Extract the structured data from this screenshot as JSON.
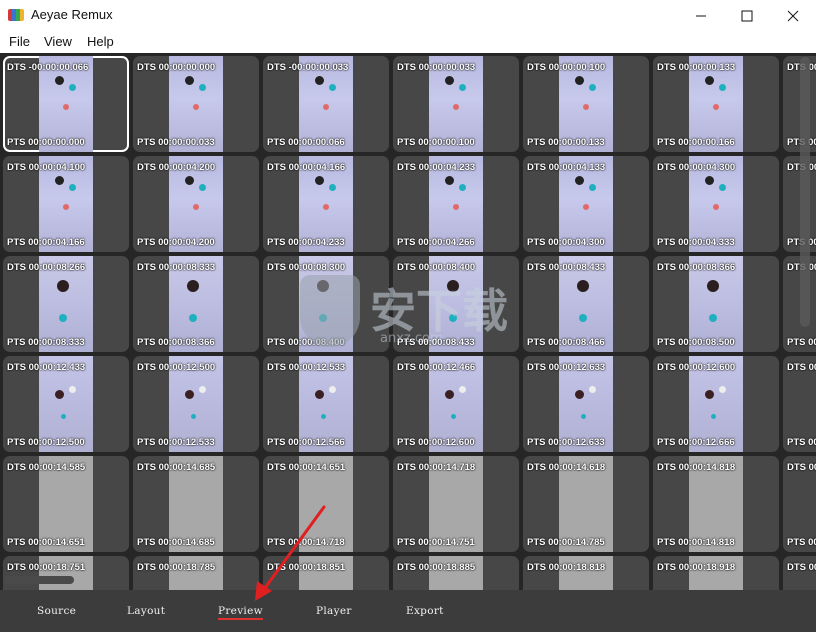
{
  "window": {
    "title": "Aeyae Remux"
  },
  "menu": {
    "file": "File",
    "view": "View",
    "help": "Help"
  },
  "grid": {
    "rows": [
      {
        "scene": "scene-a",
        "dts": [
          "DTS -00:00:00.066",
          "DTS 00:00:00.000",
          "DTS -00:00:00.033",
          "DTS 00:00:00.033",
          "DTS 00:00:00.100",
          "DTS 00:00:00.133",
          "DTS 00:"
        ],
        "pts": [
          "PTS 00:00:00.000",
          "PTS 00:00:00.033",
          "PTS 00:00:00.066",
          "PTS 00:00:00.100",
          "PTS 00:00:00.133",
          "PTS 00:00:00.166",
          "PTS 00:"
        ]
      },
      {
        "scene": "scene-a",
        "dts": [
          "DTS 00:00:04.100",
          "DTS 00:00:04.200",
          "DTS 00:00:04.166",
          "DTS 00:00:04.233",
          "DTS 00:00:04.133",
          "DTS 00:00:04.300",
          "DTS 00:"
        ],
        "pts": [
          "PTS 00:00:04.166",
          "PTS 00:00:04.200",
          "PTS 00:00:04.233",
          "PTS 00:00:04.266",
          "PTS 00:00:04.300",
          "PTS 00:00:04.333",
          "PTS 00:"
        ]
      },
      {
        "scene": "scene-b",
        "dts": [
          "DTS 00:00:08.266",
          "DTS 00:00:08.333",
          "DTS 00:00:08.300",
          "DTS 00:00:08.400",
          "DTS 00:00:08.433",
          "DTS 00:00:08.366",
          "DTS 00:"
        ],
        "pts": [
          "PTS 00:00:08.333",
          "PTS 00:00:08.366",
          "PTS 00:00:08.400",
          "PTS 00:00:08.433",
          "PTS 00:00:08.466",
          "PTS 00:00:08.500",
          "PTS 00:"
        ]
      },
      {
        "scene": "scene-c",
        "dts": [
          "DTS 00:00:12.433",
          "DTS 00:00:12.500",
          "DTS 00:00:12.533",
          "DTS 00:00:12.466",
          "DTS 00:00:12.633",
          "DTS 00:00:12.600",
          "DTS 00:"
        ],
        "pts": [
          "PTS 00:00:12.500",
          "PTS 00:00:12.533",
          "PTS 00:00:12.566",
          "PTS 00:00:12.600",
          "PTS 00:00:12.633",
          "PTS 00:00:12.666",
          "PTS 00:"
        ]
      },
      {
        "scene": "scene-d",
        "dts": [
          "DTS 00:00:14.585",
          "DTS 00:00:14.685",
          "DTS 00:00:14.651",
          "DTS 00:00:14.718",
          "DTS 00:00:14.618",
          "DTS 00:00:14.818",
          "DTS 00:"
        ],
        "pts": [
          "PTS 00:00:14.651",
          "PTS 00:00:14.685",
          "PTS 00:00:14.718",
          "PTS 00:00:14.751",
          "PTS 00:00:14.785",
          "PTS 00:00:14.818",
          "PTS 00:"
        ]
      },
      {
        "scene": "scene-d",
        "dts": [
          "DTS 00:00:18.751",
          "DTS 00:00:18.785",
          "DTS 00:00:18.851",
          "DTS 00:00:18.885",
          "DTS 00:00:18.818",
          "DTS 00:00:18.918",
          "DTS 00:"
        ],
        "pts": [
          "",
          "",
          "",
          "",
          "",
          "",
          ""
        ]
      }
    ]
  },
  "watermark": {
    "main": "安下载",
    "sub": "anxz.com"
  },
  "tabs": {
    "source": "Source",
    "layout": "Layout",
    "preview": "Preview",
    "player": "Player",
    "export": "Export"
  },
  "colors": {
    "accent_underline": "#e03030",
    "annotation_arrow": "#e02020",
    "selection_border": "#ffffff"
  }
}
